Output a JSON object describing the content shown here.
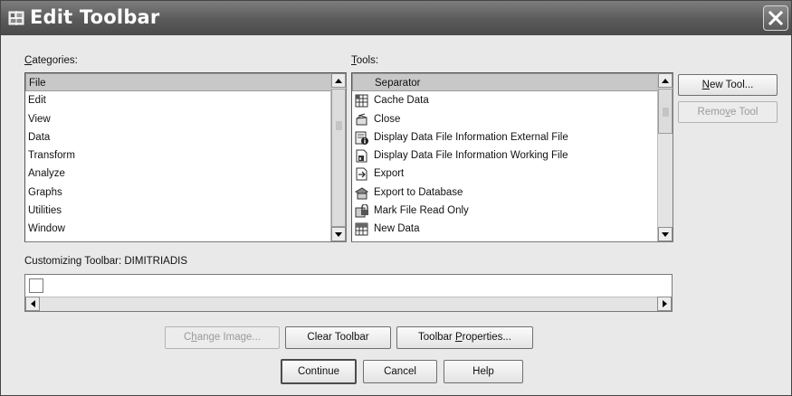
{
  "window": {
    "title": "Edit Toolbar",
    "icons": {
      "title": "toolbar-edit-icon",
      "close": "close-x-icon"
    }
  },
  "categories": {
    "label_mnemonic": "C",
    "label_rest": "ategories:",
    "items": [
      "File",
      "Edit",
      "View",
      "Data",
      "Transform",
      "Analyze",
      "Graphs",
      "Utilities",
      "Window"
    ],
    "selected": "File"
  },
  "tools": {
    "label_mnemonic": "T",
    "label_rest": "ools:",
    "items": [
      {
        "label": "Separator",
        "icon": "none"
      },
      {
        "label": "Cache Data",
        "icon": "cache-data-icon"
      },
      {
        "label": "Close",
        "icon": "close-file-icon"
      },
      {
        "label": "Display Data File Information External File",
        "icon": "data-file-info-external-icon"
      },
      {
        "label": "Display Data File Information Working File",
        "icon": "data-file-info-working-icon"
      },
      {
        "label": "Export",
        "icon": "export-icon"
      },
      {
        "label": "Export to Database",
        "icon": "export-database-icon"
      },
      {
        "label": "Mark File Read Only",
        "icon": "read-only-icon"
      },
      {
        "label": "New Data",
        "icon": "new-data-icon"
      }
    ],
    "selected": "Separator"
  },
  "side_buttons": {
    "new_tool_pre": "",
    "new_tool_mn": "N",
    "new_tool_post": "ew Tool...",
    "remove_tool_pre": "Remo",
    "remove_tool_mn": "v",
    "remove_tool_post": "e Tool"
  },
  "customizing": {
    "label": "Customizing Toolbar:  DIMITRIADIS"
  },
  "bottom_buttons": {
    "change_image_pre": "C",
    "change_image_mn": "h",
    "change_image_post": "ange Image...",
    "clear_toolbar": "Clear Toolbar",
    "toolbar_properties_pre": "Toolbar ",
    "toolbar_properties_mn": "P",
    "toolbar_properties_post": "roperties...",
    "continue": "Continue",
    "cancel": "Cancel",
    "help": "Help"
  }
}
